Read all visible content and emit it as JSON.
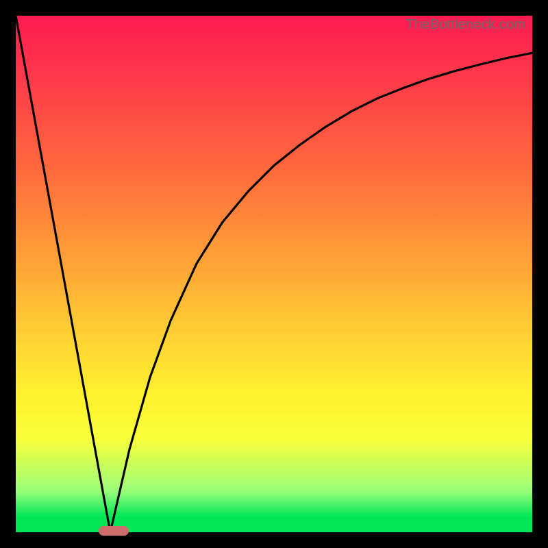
{
  "attribution": "TheBottleneck.com",
  "colors": {
    "frame_bg": "#000000",
    "gradient_top": "#ff1a52",
    "gradient_bottom": "#00e756",
    "curve_stroke": "#000000",
    "marker_fill": "#cc6d6c",
    "attribution_text": "#6b6b6b"
  },
  "chart_data": {
    "type": "line",
    "title": "",
    "xlabel": "",
    "ylabel": "",
    "xlim": [
      0,
      100
    ],
    "ylim": [
      0,
      100
    ],
    "grid": false,
    "legend": false,
    "description": "Bottleneck-style V-curve. Left branch is a steep straight line from (0,100) down to the optimum near x≈18. Right branch rises with a decelerating (concave) curve approaching ~93 at x=100. Background is a vertical heat gradient (red→green).",
    "series": [
      {
        "name": "left-branch",
        "x": [
          0,
          18.3
        ],
        "y": [
          100,
          0
        ]
      },
      {
        "name": "right-branch",
        "x": [
          18.3,
          22,
          26,
          30,
          35,
          40,
          45,
          50,
          55,
          60,
          65,
          70,
          75,
          80,
          85,
          90,
          95,
          100
        ],
        "y": [
          0,
          16,
          30,
          41,
          52,
          60,
          66,
          71,
          75,
          78.5,
          81.5,
          84,
          86,
          87.8,
          89.3,
          90.6,
          91.8,
          92.8
        ]
      }
    ],
    "marker": {
      "x_center": 19.0,
      "width_frac": 0.058,
      "y": 0.3
    }
  }
}
